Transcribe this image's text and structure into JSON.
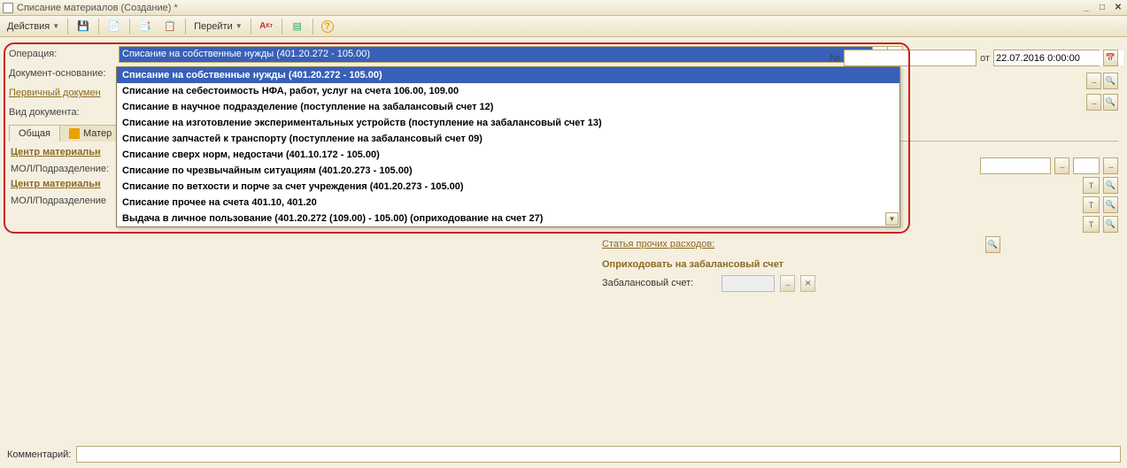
{
  "window": {
    "title": "Списание материалов (Создание) *"
  },
  "toolbar": {
    "actions": "Действия",
    "goto": "Перейти"
  },
  "labels": {
    "operation": "Операция:",
    "basis": "Документ-основание:",
    "primary": "Первичный докумен",
    "doctype": "Вид документа:",
    "number": "№",
    "from": "от",
    "center1": "Центр материальн",
    "mol1": "МОЛ/Подразделение:",
    "center2": "Центр материальн",
    "mol2": "МОЛ/Подразделение",
    "expense": "Статья прочих расходов:",
    "offbalance_heading": "Оприходовать на забалансовый счет",
    "offbalance": "Забалансовый счет:",
    "comment": "Комментарий:"
  },
  "date": "22.07.2016 0:00:00",
  "combo": {
    "selected": "Списание на собственные нужды (401.20.272 - 105.00)",
    "options": [
      "Списание на собственные нужды (401.20.272 - 105.00)",
      "Списание на себестоимость НФА, работ, услуг на счета 106.00, 109.00",
      "Списание в научное подразделение (поступление на забалансовый счет 12)",
      "Списание на изготовление экспериментальных устройств (поступление на забалансовый счет 13)",
      "Списание запчастей к транспорту (поступление на забалансовый счет 09)",
      "Списание сверх норм, недостачи (401.10.172 - 105.00)",
      "Списание по чрезвычайным ситуациям (401.20.273 - 105.00)",
      "Списание по ветхости и порче за счет учреждения (401.20.273 - 105.00)",
      "Списание прочее на счета 401.10, 401.20",
      "Выдача в личное пользование (401.20.272 (109.00) - 105.00) (оприходование на счет 27)"
    ]
  },
  "tabs": {
    "t1": "Общая",
    "t2": "Матер"
  },
  "icons": {
    "calendar": "📅",
    "search": "🔍",
    "help": "?",
    "close": "✕"
  }
}
